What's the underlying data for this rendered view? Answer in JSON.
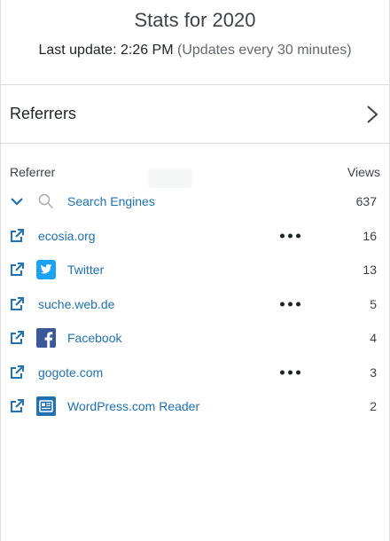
{
  "header": {
    "title": "Stats for 2020",
    "last_update_label": "Last update: 2:26 PM",
    "update_note": "(Updates every 30 minutes)"
  },
  "nav": {
    "label": "Referrers",
    "chevron_icon": "chevron-right-icon"
  },
  "table": {
    "col_referrer": "Referrer",
    "col_views": "Views",
    "rows": [
      {
        "label": "Search Engines",
        "views": "637",
        "lead_icon": "chevron-down-icon",
        "logo_icon": "search-icon",
        "has_menu": false
      },
      {
        "label": "ecosia.org",
        "views": "16",
        "lead_icon": "external-link-icon",
        "logo_icon": "",
        "has_menu": true
      },
      {
        "label": "Twitter",
        "views": "13",
        "lead_icon": "external-link-icon",
        "logo_icon": "twitter-icon",
        "has_menu": false
      },
      {
        "label": "suche.web.de",
        "views": "5",
        "lead_icon": "external-link-icon",
        "logo_icon": "",
        "has_menu": true
      },
      {
        "label": "Facebook",
        "views": "4",
        "lead_icon": "external-link-icon",
        "logo_icon": "facebook-icon",
        "has_menu": false
      },
      {
        "label": "gogote.com",
        "views": "3",
        "lead_icon": "external-link-icon",
        "logo_icon": "",
        "has_menu": true
      },
      {
        "label": "WordPress.com Reader",
        "views": "2",
        "lead_icon": "external-link-icon",
        "logo_icon": "wordpress-reader-icon",
        "has_menu": false
      }
    ]
  },
  "colors": {
    "link": "#2271b1",
    "twitter": "#1da1f2",
    "facebook": "#3b5998",
    "reader": "#2271b1"
  }
}
